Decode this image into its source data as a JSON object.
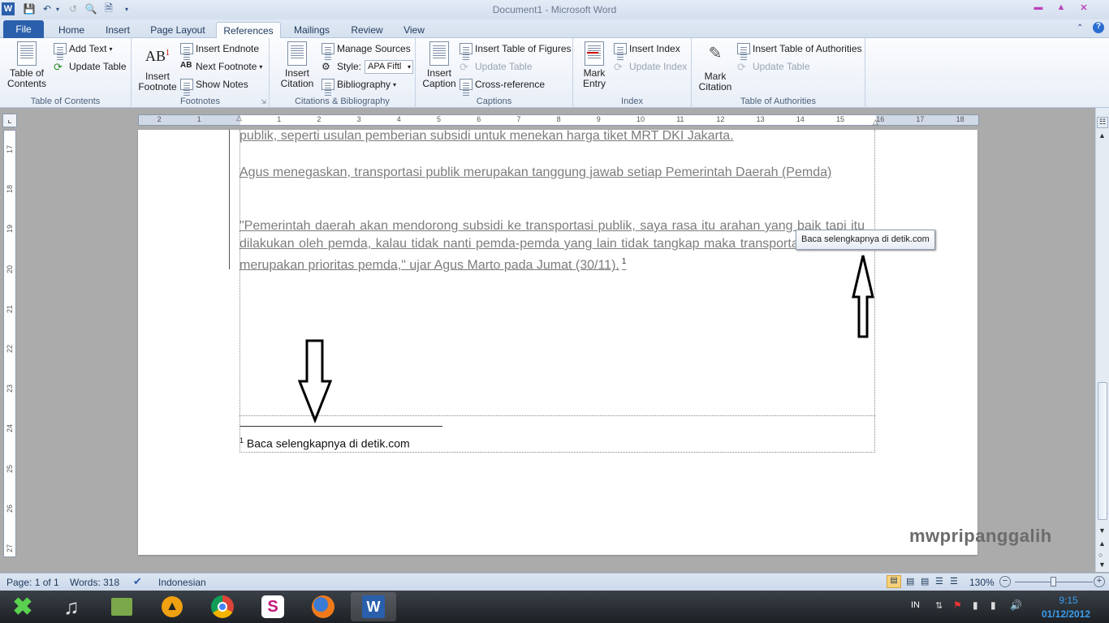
{
  "window": {
    "title": "Document1  -  Microsoft Word"
  },
  "ribbon_tabs": [
    "File",
    "Home",
    "Insert",
    "Page Layout",
    "References",
    "Mailings",
    "Review",
    "View"
  ],
  "ribbon": {
    "toc": {
      "table_of_contents": "Table of\nContents",
      "add_text": "Add Text",
      "update_table": "Update Table",
      "label": "Table of Contents"
    },
    "footnotes": {
      "insert_footnote": "Insert\nFootnote",
      "insert_endnote": "Insert Endnote",
      "next_footnote": "Next Footnote",
      "show_notes": "Show Notes",
      "label": "Footnotes"
    },
    "citations": {
      "insert_citation": "Insert\nCitation",
      "manage_sources": "Manage Sources",
      "style_label": "Style:",
      "style_value": "APA Fiftl",
      "bibliography": "Bibliography",
      "label": "Citations & Bibliography"
    },
    "captions": {
      "insert_caption": "Insert\nCaption",
      "insert_table_of_figures": "Insert Table of Figures",
      "update_table": "Update Table",
      "cross_reference": "Cross-reference",
      "label": "Captions"
    },
    "index": {
      "mark_entry": "Mark\nEntry",
      "insert_index": "Insert Index",
      "update_index": "Update Index",
      "label": "Index"
    },
    "authorities": {
      "mark_citation": "Mark\nCitation",
      "insert_table_of_authorities": "Insert Table of Authorities",
      "update_table": "Update Table",
      "label": "Table of Authorities"
    }
  },
  "ruler": {
    "h_ticks": [
      "2",
      "1",
      "1",
      "2",
      "3",
      "4",
      "5",
      "6",
      "7",
      "8",
      "9",
      "10",
      "11",
      "12",
      "13",
      "14",
      "15",
      "16",
      "17",
      "18"
    ],
    "v_ticks": [
      "17",
      "18",
      "19",
      "20",
      "21",
      "22",
      "23",
      "24",
      "25",
      "26",
      "27"
    ]
  },
  "document": {
    "line1": "publik, seperti usulan pemberian subsidi untuk menekan harga tiket MRT DKI Jakarta.",
    "para2": "Agus menegaskan, transportasi publik merupakan tanggung jawab setiap Pemerintah Daerah (Pemda)",
    "para3": "\"Pemerintah daerah akan mendorong subsidi ke transportasi publik, saya rasa itu arahan yang baik tapi itu dilakukan oleh pemda, kalau tidak nanti pemda-pemda yang lain tidak tangkap maka transportasi publik itu merupakan prioritas pemda,\" ujar Agus Marto pada Jumat (30/11).",
    "footnote_ref": "1",
    "footnote_mark": "1",
    "footnote_text": "Baca selengkapnya di detik.com",
    "tooltip": "Baca selengkapnya di detik.com",
    "watermark": "mwpripanggalih"
  },
  "statusbar": {
    "page": "Page: 1 of 1",
    "words": "Words: 318",
    "language": "Indonesian",
    "zoom": "130%"
  },
  "taskbar": {
    "language": "IN",
    "time": "9:15",
    "date": "01/12/2012"
  }
}
